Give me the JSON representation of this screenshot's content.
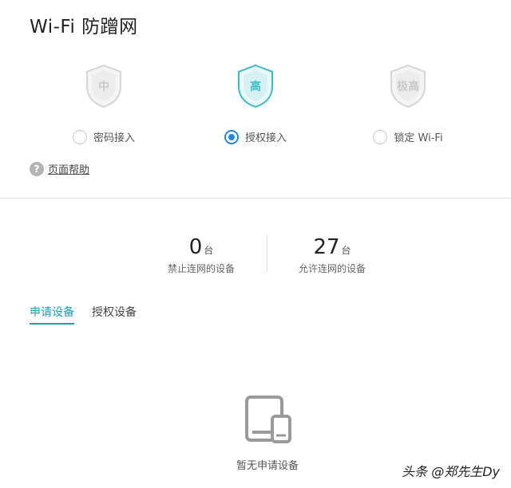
{
  "page": {
    "title": "Wi-Fi 防蹭网"
  },
  "levels": [
    {
      "badge": "中",
      "label": "密码接入",
      "selected": false,
      "color": "#d6d6d6"
    },
    {
      "badge": "高",
      "label": "授权接入",
      "selected": true,
      "color": "#3dbcc6"
    },
    {
      "badge": "极高",
      "label": "锁定 Wi-Fi",
      "selected": false,
      "color": "#d6d6d6"
    }
  ],
  "help": {
    "icon": "question-icon",
    "label": "页面帮助"
  },
  "stats": {
    "blocked": {
      "value": "0",
      "unit": "台",
      "label": "禁止连网的设备"
    },
    "allowed": {
      "value": "27",
      "unit": "台",
      "label": "允许连网的设备"
    }
  },
  "tabs": [
    {
      "label": "申请设备",
      "active": true
    },
    {
      "label": "授权设备",
      "active": false
    }
  ],
  "empty": {
    "icon": "tablet-phone-icon",
    "text": "暂无申请设备"
  },
  "watermark": "头条 @郑先生Dy",
  "colors": {
    "accent": "#17a2b8",
    "radio": "#1e88e5",
    "inactive_shield": "#d6d6d6"
  }
}
